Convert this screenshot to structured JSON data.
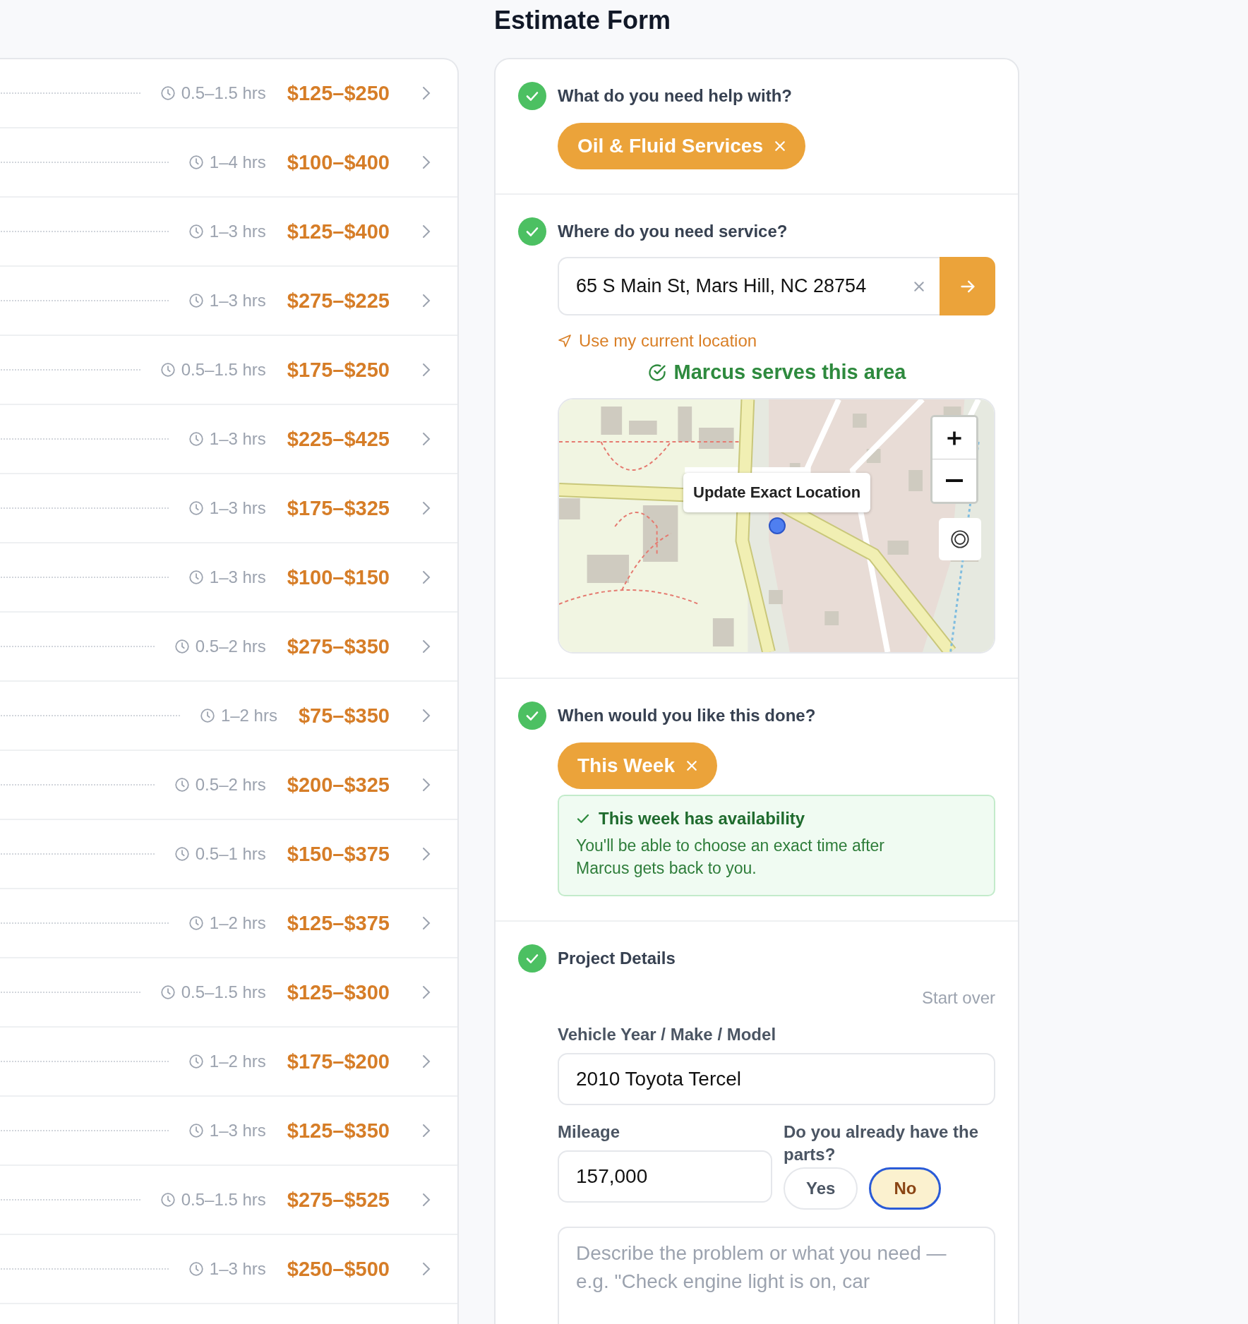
{
  "page": {
    "title": "Estimate Form"
  },
  "services": [
    {
      "duration": "0.5–1.5 hrs",
      "price": "$125–$250"
    },
    {
      "duration": "1–4 hrs",
      "price": "$100–$400"
    },
    {
      "duration": "1–3 hrs",
      "price": "$125–$400"
    },
    {
      "duration": "1–3 hrs",
      "price": "$275–$225"
    },
    {
      "duration": "0.5–1.5 hrs",
      "price": "$175–$250"
    },
    {
      "duration": "1–3 hrs",
      "price": "$225–$425"
    },
    {
      "duration": "1–3 hrs",
      "price": "$175–$325"
    },
    {
      "duration": "1–3 hrs",
      "price": "$100–$150"
    },
    {
      "duration": "0.5–2 hrs",
      "price": "$275–$350"
    },
    {
      "duration": "1–2 hrs",
      "price": "$75–$350"
    },
    {
      "duration": "0.5–2 hrs",
      "price": "$200–$325"
    },
    {
      "duration": "0.5–1 hrs",
      "price": "$150–$375"
    },
    {
      "duration": "1–2 hrs",
      "price": "$125–$375"
    },
    {
      "duration": "0.5–1.5 hrs",
      "price": "$125–$300"
    },
    {
      "duration": "1–2 hrs",
      "price": "$175–$200"
    },
    {
      "duration": "1–3 hrs",
      "price": "$125–$350"
    },
    {
      "duration": "0.5–1.5 hrs",
      "price": "$275–$525"
    },
    {
      "duration": "1–3 hrs",
      "price": "$250–$500"
    }
  ],
  "form": {
    "service": {
      "complete": true,
      "question": "What do you need help with?",
      "chip": "Oil & Fluid Services"
    },
    "location": {
      "complete": true,
      "question": "Where do you need service?",
      "address": "65 S Main St, Mars Hill, NC 28754",
      "use_location": "Use my current location",
      "coverage": "Marcus serves this area",
      "map_tooltip": "Update Exact Location"
    },
    "timing": {
      "complete": true,
      "question": "When would you like this done?",
      "chip": "This Week",
      "availability": {
        "title": "This week has availability",
        "text": "You'll be able to choose an exact time after Marcus gets back to you."
      }
    },
    "details": {
      "complete": true,
      "title": "Project Details",
      "start_over": "Start over",
      "vehicle": {
        "label": "Vehicle Year / Make / Model",
        "value": "2010 Toyota Tercel"
      },
      "mileage": {
        "label": "Mileage",
        "value": "157,000"
      },
      "parts": {
        "label": "Do you already have the parts?",
        "options": [
          {
            "label": "Yes",
            "selected": false
          },
          {
            "label": "No",
            "selected": true
          }
        ]
      },
      "description": {
        "placeholder": "Describe the problem or what you need — e.g. \"Check engine light is on, car"
      }
    }
  }
}
